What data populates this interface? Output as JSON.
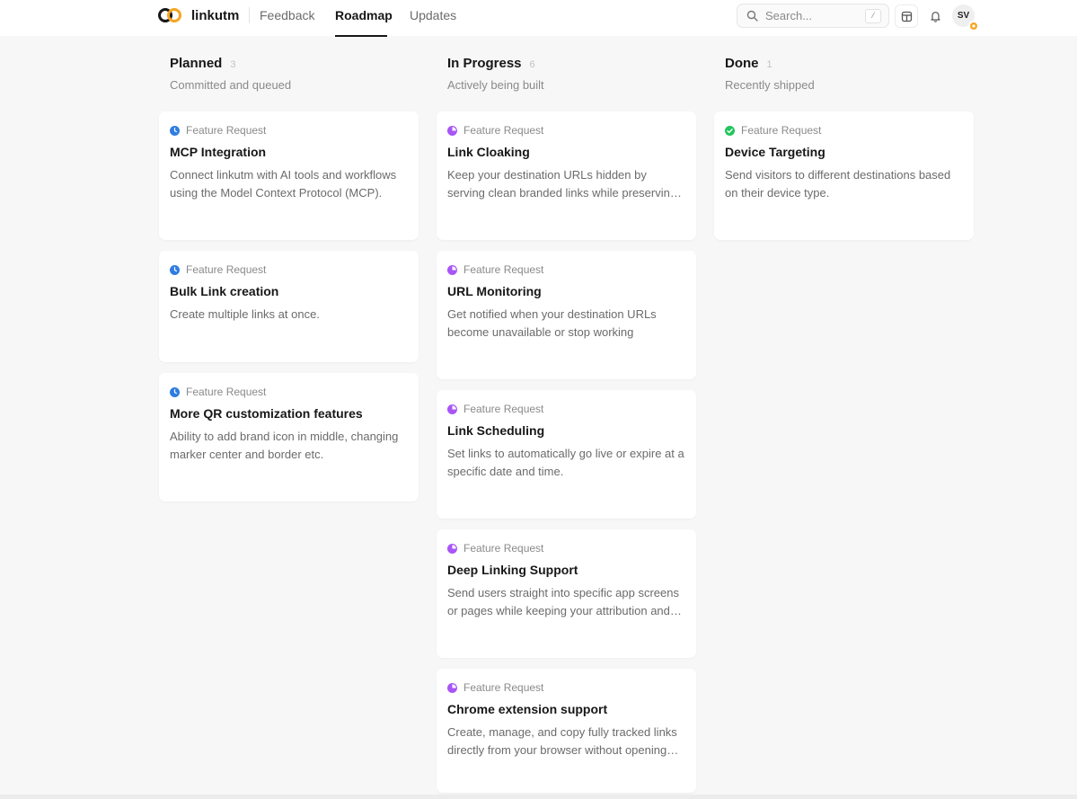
{
  "brand": {
    "name": "linkutm",
    "accent": "#f5a524"
  },
  "nav": {
    "tabs": [
      {
        "label": "Feedback",
        "active": false
      },
      {
        "label": "Roadmap",
        "active": true
      },
      {
        "label": "Updates",
        "active": false
      }
    ]
  },
  "search": {
    "placeholder": "Search...",
    "shortcut": "/"
  },
  "header_icons": [
    "board-icon",
    "bell-icon"
  ],
  "user": {
    "initials": "SV"
  },
  "columns": [
    {
      "title": "Planned",
      "count": "3",
      "subtitle": "Committed and queued",
      "status_color": "#2f7de1",
      "cards": [
        {
          "type": "Feature Request",
          "title": "MCP Integration",
          "description": "Connect linkutm with AI tools and workflows using the Model Context Protocol (MCP)."
        },
        {
          "type": "Feature Request",
          "title": "Bulk Link creation",
          "description": "Create multiple links at once."
        },
        {
          "type": "Feature Request",
          "title": "More QR customization features",
          "description": "Ability to add brand icon in middle, changing marker center and border etc."
        }
      ]
    },
    {
      "title": "In Progress",
      "count": "6",
      "subtitle": "Actively being built",
      "status_color": "#a855f7",
      "cards": [
        {
          "type": "Feature Request",
          "title": "Link Cloaking",
          "description": "Keep your destination URLs hidden by serving clean branded links while preserving tracking."
        },
        {
          "type": "Feature Request",
          "title": "URL Monitoring",
          "description": "Get notified when your destination URLs become unavailable or stop working"
        },
        {
          "type": "Feature Request",
          "title": "Link Scheduling",
          "description": "Set links to automatically go live or expire at a specific date and time."
        },
        {
          "type": "Feature Request",
          "title": "Deep Linking Support",
          "description": "Send users straight into specific app screens or pages while keeping your attribution and tracking."
        },
        {
          "type": "Feature Request",
          "title": "Chrome extension support",
          "description": "Create, manage, and copy fully tracked links directly from your browser without opening the dashboard."
        }
      ]
    },
    {
      "title": "Done",
      "count": "1",
      "subtitle": "Recently shipped",
      "status_color": "#22c55e",
      "cards": [
        {
          "type": "Feature Request",
          "title": "Device Targeting",
          "description": "Send visitors to different destinations based on their device type."
        }
      ]
    }
  ]
}
